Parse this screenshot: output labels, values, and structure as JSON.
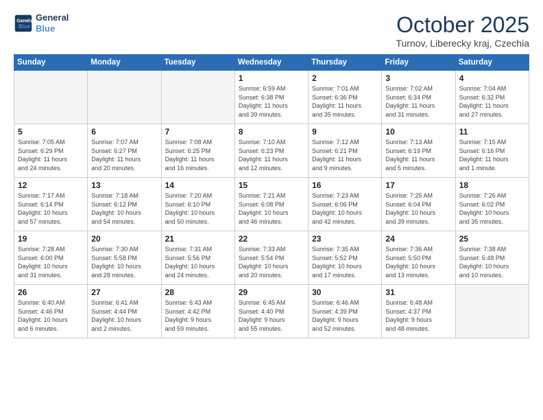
{
  "header": {
    "logo_line1": "General",
    "logo_line2": "Blue",
    "month": "October 2025",
    "location": "Turnov, Liberecky kraj, Czechia"
  },
  "days_of_week": [
    "Sunday",
    "Monday",
    "Tuesday",
    "Wednesday",
    "Thursday",
    "Friday",
    "Saturday"
  ],
  "weeks": [
    [
      {
        "num": "",
        "info": ""
      },
      {
        "num": "",
        "info": ""
      },
      {
        "num": "",
        "info": ""
      },
      {
        "num": "1",
        "info": "Sunrise: 6:59 AM\nSunset: 6:38 PM\nDaylight: 11 hours\nand 39 minutes."
      },
      {
        "num": "2",
        "info": "Sunrise: 7:01 AM\nSunset: 6:36 PM\nDaylight: 11 hours\nand 35 minutes."
      },
      {
        "num": "3",
        "info": "Sunrise: 7:02 AM\nSunset: 6:34 PM\nDaylight: 11 hours\nand 31 minutes."
      },
      {
        "num": "4",
        "info": "Sunrise: 7:04 AM\nSunset: 6:32 PM\nDaylight: 11 hours\nand 27 minutes."
      }
    ],
    [
      {
        "num": "5",
        "info": "Sunrise: 7:05 AM\nSunset: 6:29 PM\nDaylight: 11 hours\nand 24 minutes."
      },
      {
        "num": "6",
        "info": "Sunrise: 7:07 AM\nSunset: 6:27 PM\nDaylight: 11 hours\nand 20 minutes."
      },
      {
        "num": "7",
        "info": "Sunrise: 7:08 AM\nSunset: 6:25 PM\nDaylight: 11 hours\nand 16 minutes."
      },
      {
        "num": "8",
        "info": "Sunrise: 7:10 AM\nSunset: 6:23 PM\nDaylight: 11 hours\nand 12 minutes."
      },
      {
        "num": "9",
        "info": "Sunrise: 7:12 AM\nSunset: 6:21 PM\nDaylight: 11 hours\nand 9 minutes."
      },
      {
        "num": "10",
        "info": "Sunrise: 7:13 AM\nSunset: 6:19 PM\nDaylight: 11 hours\nand 5 minutes."
      },
      {
        "num": "11",
        "info": "Sunrise: 7:15 AM\nSunset: 6:16 PM\nDaylight: 11 hours\nand 1 minute."
      }
    ],
    [
      {
        "num": "12",
        "info": "Sunrise: 7:17 AM\nSunset: 6:14 PM\nDaylight: 10 hours\nand 57 minutes."
      },
      {
        "num": "13",
        "info": "Sunrise: 7:18 AM\nSunset: 6:12 PM\nDaylight: 10 hours\nand 54 minutes."
      },
      {
        "num": "14",
        "info": "Sunrise: 7:20 AM\nSunset: 6:10 PM\nDaylight: 10 hours\nand 50 minutes."
      },
      {
        "num": "15",
        "info": "Sunrise: 7:21 AM\nSunset: 6:08 PM\nDaylight: 10 hours\nand 46 minutes."
      },
      {
        "num": "16",
        "info": "Sunrise: 7:23 AM\nSunset: 6:06 PM\nDaylight: 10 hours\nand 42 minutes."
      },
      {
        "num": "17",
        "info": "Sunrise: 7:25 AM\nSunset: 6:04 PM\nDaylight: 10 hours\nand 39 minutes."
      },
      {
        "num": "18",
        "info": "Sunrise: 7:26 AM\nSunset: 6:02 PM\nDaylight: 10 hours\nand 35 minutes."
      }
    ],
    [
      {
        "num": "19",
        "info": "Sunrise: 7:28 AM\nSunset: 6:00 PM\nDaylight: 10 hours\nand 31 minutes."
      },
      {
        "num": "20",
        "info": "Sunrise: 7:30 AM\nSunset: 5:58 PM\nDaylight: 10 hours\nand 28 minutes."
      },
      {
        "num": "21",
        "info": "Sunrise: 7:31 AM\nSunset: 5:56 PM\nDaylight: 10 hours\nand 24 minutes."
      },
      {
        "num": "22",
        "info": "Sunrise: 7:33 AM\nSunset: 5:54 PM\nDaylight: 10 hours\nand 20 minutes."
      },
      {
        "num": "23",
        "info": "Sunrise: 7:35 AM\nSunset: 5:52 PM\nDaylight: 10 hours\nand 17 minutes."
      },
      {
        "num": "24",
        "info": "Sunrise: 7:36 AM\nSunset: 5:50 PM\nDaylight: 10 hours\nand 13 minutes."
      },
      {
        "num": "25",
        "info": "Sunrise: 7:38 AM\nSunset: 5:48 PM\nDaylight: 10 hours\nand 10 minutes."
      }
    ],
    [
      {
        "num": "26",
        "info": "Sunrise: 6:40 AM\nSunset: 4:46 PM\nDaylight: 10 hours\nand 6 minutes."
      },
      {
        "num": "27",
        "info": "Sunrise: 6:41 AM\nSunset: 4:44 PM\nDaylight: 10 hours\nand 2 minutes."
      },
      {
        "num": "28",
        "info": "Sunrise: 6:43 AM\nSunset: 4:42 PM\nDaylight: 9 hours\nand 59 minutes."
      },
      {
        "num": "29",
        "info": "Sunrise: 6:45 AM\nSunset: 4:40 PM\nDaylight: 9 hours\nand 55 minutes."
      },
      {
        "num": "30",
        "info": "Sunrise: 6:46 AM\nSunset: 4:39 PM\nDaylight: 9 hours\nand 52 minutes."
      },
      {
        "num": "31",
        "info": "Sunrise: 6:48 AM\nSunset: 4:37 PM\nDaylight: 9 hours\nand 48 minutes."
      },
      {
        "num": "",
        "info": ""
      }
    ]
  ]
}
